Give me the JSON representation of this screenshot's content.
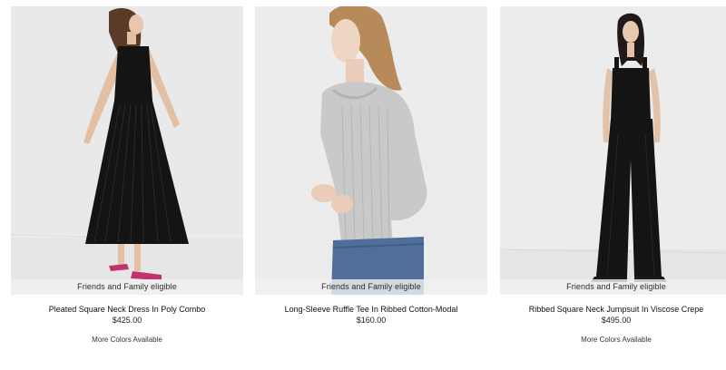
{
  "products": [
    {
      "name": "Pleated Square Neck Dress In Poly Combo",
      "price": "$425.00",
      "badge": "Friends and Family eligible",
      "more_colors": "More Colors Available"
    },
    {
      "name": "Long-Sleeve Ruffle Tee In Ribbed Cotton-Modal",
      "price": "$160.00",
      "badge": "Friends and Family eligible",
      "more_colors": ""
    },
    {
      "name": "Ribbed Square Neck Jumpsuit In Viscose Crepe",
      "price": "$495.00",
      "badge": "Friends and Family eligible",
      "more_colors": "More Colors Available"
    }
  ],
  "colors": {
    "photo_background": "#ececec",
    "badge_background": "#f0f0f0",
    "garment_black": "#141414",
    "garment_grey": "#c9c9c9",
    "denim": "#4f6f9a",
    "shoe_pink": "#c2336e"
  }
}
